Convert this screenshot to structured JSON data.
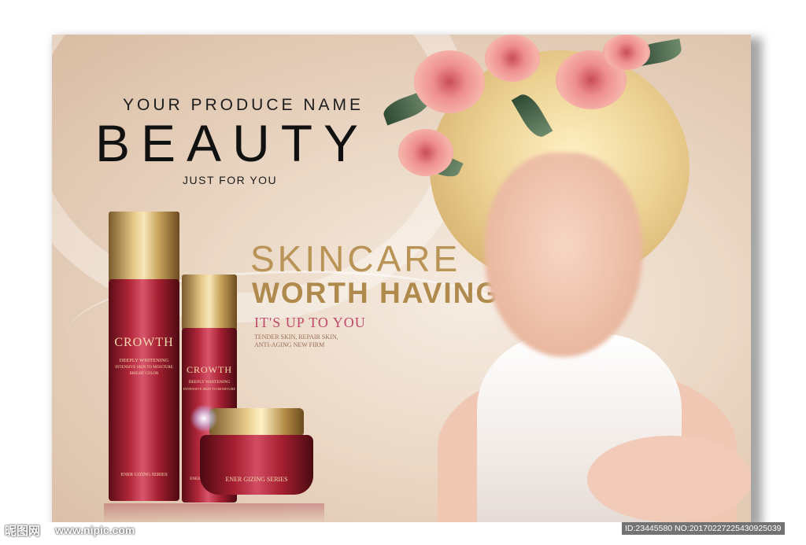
{
  "poster": {
    "produce_name": "YOUR PRODUCE NAME",
    "beauty": "BEAUTY",
    "just_for_you": "JUST FOR YOU",
    "skincare": "SKINCARE",
    "worth_having": "WORTH HAVING",
    "up_to_you": "IT'S UP TO YOU",
    "desc_lines": [
      "TENDER SKIN, REPAIR SKIN,",
      "ANTI-AGING NEW FIRM"
    ],
    "bottle_brand": "CROWTH",
    "bottle_line1": "DEEPLY WHITENING",
    "bottle_line2": "INTENSIVE SKIN TO MOISTURE",
    "bottle_line3": "BRIGHT COLOR",
    "series_label": "ENER GIZING SERIES",
    "jar_label": "ENER GIZING SERIES"
  },
  "watermark": {
    "logo": "昵图网",
    "url": "www.nipic.com",
    "id": "ID:23445580 NO:20170227225430925039"
  },
  "colors": {
    "gold": "#b99456",
    "rose": "#c0496a",
    "bottle_red": "#a51f31"
  }
}
